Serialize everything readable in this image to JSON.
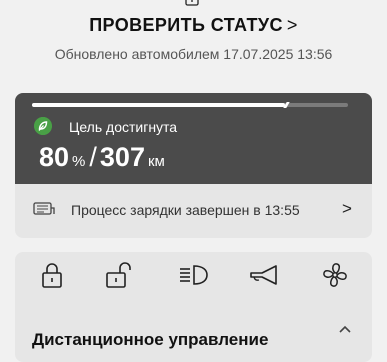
{
  "header": {
    "status_link_label": "ПРОВЕРИТЬ СТАТУС",
    "status_link_chevron": ">",
    "updated_text": "Обновлено автомобилем 17.07.2025 13:56"
  },
  "charging": {
    "goal_label": "Цель достигнута",
    "battery_percent": "80",
    "percent_unit": "%",
    "separator": "/",
    "range": "307",
    "range_unit": "км",
    "progress_fraction": 0.8,
    "status_text": "Процесс зарядки завершен в 13:55",
    "status_chevron": ">"
  },
  "remote_control": {
    "title": "Дистанционное управление",
    "buttons": [
      {
        "icon": "lock-icon"
      },
      {
        "icon": "unlock-icon"
      },
      {
        "icon": "headlights-icon"
      },
      {
        "icon": "horn-icon"
      },
      {
        "icon": "fan-icon"
      }
    ]
  },
  "colors": {
    "card_dark": "#4b4b4b",
    "card_light": "#e6e6e6",
    "background": "#f1f1f1",
    "leaf_green": "#49a046"
  }
}
